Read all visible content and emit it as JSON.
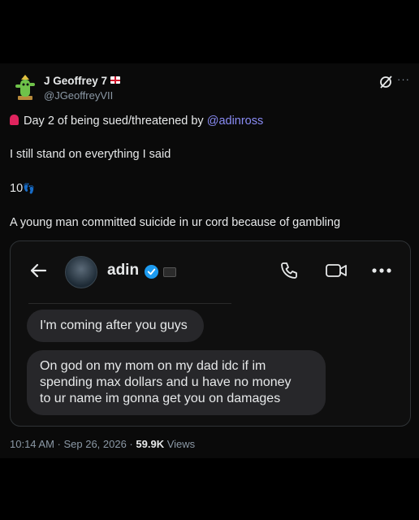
{
  "author": {
    "name": "J Geoffrey 7",
    "handle": "@JGeoffreyVII"
  },
  "tweet": {
    "line1_text": "Day 2 of being sued/threatened by ",
    "line1_mention": "@adinross",
    "line2": "I still stand on everything I said",
    "line3_text": "10",
    "line3_emoji": "👣",
    "line4": "A young man committed suicide in ur cord because of gambling"
  },
  "dm": {
    "contact_name": "adin",
    "messages": [
      "I'm coming after you guys",
      "On god on my mom on my dad idc if im\nspending max dollars and u have no money\nto ur name im gonna get you on damages"
    ]
  },
  "meta": {
    "time": "10:14 AM · Sep 26, 2026 · ",
    "views_count": "59.9K",
    "views_label": " Views"
  },
  "colors": {
    "mention": "#8a8cf5",
    "verified": "#1d9bf0",
    "background": "#000000"
  },
  "icons": [
    "grok-icon",
    "more-icon",
    "back-arrow-icon",
    "verified-icon",
    "phone-icon",
    "video-icon",
    "more-dots-icon",
    "alarm-icon"
  ]
}
